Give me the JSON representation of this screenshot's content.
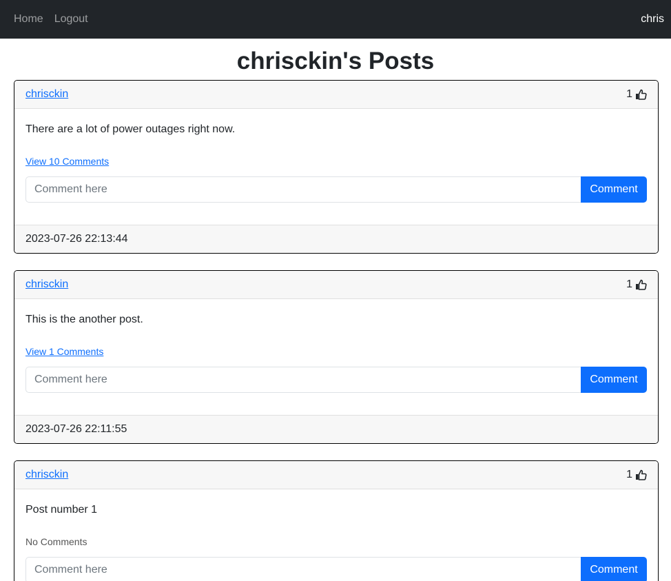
{
  "nav": {
    "links": [
      {
        "label": "Home"
      },
      {
        "label": "Logout"
      }
    ],
    "user": "chris"
  },
  "page": {
    "title": "chrisckin's Posts"
  },
  "posts": [
    {
      "author": "chrisckin",
      "likes": "1",
      "text": "There are a lot of power outages right now.",
      "comments_label": "View 10 Comments",
      "comment_placeholder": "Comment here",
      "comment_button": "Comment",
      "timestamp": "2023-07-26 22:13:44"
    },
    {
      "author": "chrisckin",
      "likes": "1",
      "text": "This is the another post.",
      "comments_label": "View 1 Comments",
      "comment_placeholder": "Comment here",
      "comment_button": "Comment",
      "timestamp": "2023-07-26 22:11:55"
    },
    {
      "author": "chrisckin",
      "likes": "1",
      "text": "Post number 1",
      "comments_label": "No Comments",
      "comment_placeholder": "Comment here",
      "comment_button": "Comment",
      "timestamp": ""
    }
  ],
  "icons": {
    "like": "thumbs-up-icon"
  },
  "colors": {
    "navbar_bg": "#212529",
    "primary": "#0d6efd",
    "card_header_bg": "#f7f7f7"
  }
}
